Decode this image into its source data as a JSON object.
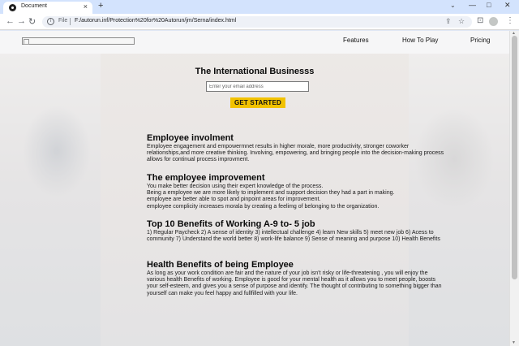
{
  "browser": {
    "tab_title": "Document",
    "tab_close": "×",
    "new_tab": "+",
    "tab_search": "⌄",
    "window_buttons": [
      "—",
      "□",
      "✕"
    ],
    "nav": {
      "back": "←",
      "forward": "→",
      "reload": "↻"
    },
    "info": "i",
    "scheme_label": "File",
    "url": "F:/autorun.inf/Protection%20for%20Autorun/jm/Serna/index.html",
    "omni_icons": [
      "⇪",
      "☆"
    ],
    "toolbar_icons": [
      "⊡",
      "⋮"
    ]
  },
  "nav": {
    "links": [
      "Features",
      "How To Play",
      "Pricing"
    ]
  },
  "hero": {
    "title": "The International Businesss",
    "email_placeholder": "Enter your email address",
    "cta_label": "GET STARTED"
  },
  "sections": [
    {
      "heading": "Employee involment",
      "body": "Employee engagement and empowermnet results in higher morale, more productivity, stronger coworker relationships,and more creative thinking. Involving, empowering, and bringing people into the decision-making process allows for continual process improvment."
    },
    {
      "heading": "The employee improvement",
      "lines": [
        "You make better decision using their expert knowledge of the process.",
        "Being a employee we are more likely to implement and support decision they had a part in making.",
        "employee are better able to spot and pinpoint areas for improvement.",
        "employee complicity increases morala by creating a feelimg of belonging to the organization."
      ]
    },
    {
      "heading": "Top 10 Benefits of Working A-9 to- 5 job",
      "body": "1) Regular Paycheck 2) A sense of identity 3) intellectual challenge 4) learn New skills 5) meet new job 6) Acess to community 7) Understand the world better 8) work-life balance 9) Sense of meaning and purpose 10) Health Benefits"
    },
    {
      "heading": "Health Benefits of being Employee",
      "body": "As long as your work condition are fair and the nature of your job isn't risky or life-threatening , you will enjoy the various health Benefits of working. Employee is good for your mental health as it allows you to meet people, boosts your self-esteem, and gives you a sense of purpose and identify. The thought of contributing to something bigger than yourself can make you feel happy and fullfilled with your life."
    }
  ],
  "colors": {
    "cta": "#f2c200",
    "tabstrip": "#d3e3fd"
  }
}
